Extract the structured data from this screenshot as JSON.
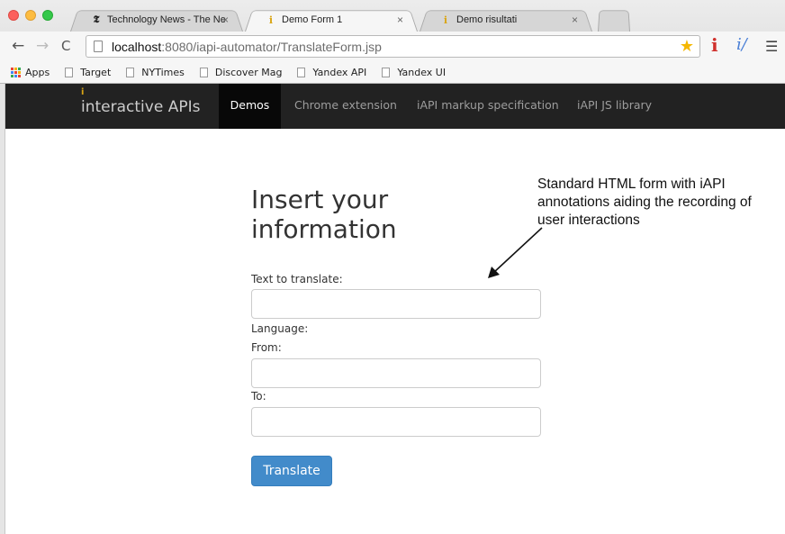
{
  "browser": {
    "tabs": [
      {
        "favicon": "𝕿",
        "title": "Technology News - The Ne",
        "close": "×"
      },
      {
        "favicon": "i",
        "title": "Demo Form 1",
        "close": "×"
      },
      {
        "favicon": "i",
        "title": "Demo risultati",
        "close": "×"
      }
    ],
    "url_host": "localhost",
    "url_rest": ":8080/iapi-automator/TranslateForm.jsp",
    "bookmarks": [
      "Apps",
      "Target",
      "NYTimes",
      "Discover Mag",
      "Yandex API",
      "Yandex UI"
    ],
    "icons": {
      "back": "back-arrow-icon",
      "forward": "forward-arrow-icon",
      "reload": "reload-icon",
      "star": "bookmark-star-icon",
      "menu": "hamburger-menu-icon"
    },
    "colors": {
      "star": "#f5b700",
      "ext_red": "#d0312d",
      "ext_blue": "#4a7fd6"
    }
  },
  "navbar": {
    "brand_mark": "i",
    "brand_text": "interactive APIs",
    "items": [
      "Demos",
      "Chrome extension",
      "iAPI markup specification",
      "iAPI JS library"
    ],
    "active": "Demos"
  },
  "form": {
    "title": "Insert your information",
    "text_label": "Text to translate:",
    "language_label": "Language:",
    "from_label": "From:",
    "to_label": "To:",
    "text_value": "",
    "from_value": "",
    "to_value": "",
    "submit_label": "Translate",
    "colors": {
      "primary": "#428bca"
    }
  },
  "annotation": {
    "text": "Standard HTML form with iAPI annotations aiding the recording of user interactions"
  }
}
